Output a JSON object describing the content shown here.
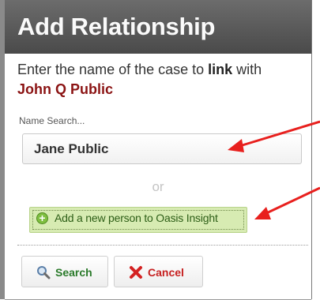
{
  "dialog": {
    "title": "Add Relationship",
    "prompt_prefix": "Enter the name of the case to ",
    "prompt_bold": "link",
    "prompt_suffix": " with",
    "person_name": "John Q Public",
    "search_label": "Name Search...",
    "search_value": "Jane Public",
    "or_text": "or",
    "add_person_label": "Add a new person to Oasis Insight",
    "search_button_label": "Search",
    "cancel_button_label": "Cancel"
  },
  "icons": {
    "add": "plus-circle-icon",
    "search": "magnifier-icon",
    "cancel": "x-icon"
  },
  "colors": {
    "titlebar": "#555555",
    "person_name": "#8b1313",
    "add_background": "#d7ebb2",
    "search_text": "#2a7a2a",
    "cancel_text": "#c62020",
    "annotation_arrow": "#e8201e"
  }
}
